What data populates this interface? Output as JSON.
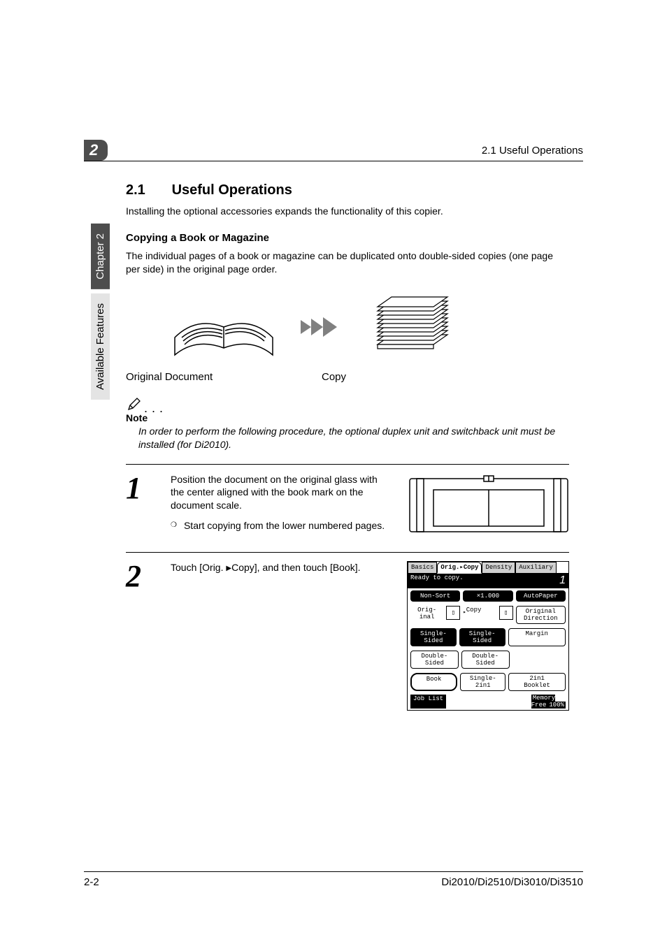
{
  "header": {
    "chapter_num": "2",
    "running_head": "2.1 Useful Operations"
  },
  "side_tabs": {
    "chapter": "Chapter 2",
    "section": "Available Features"
  },
  "section": {
    "number": "2.1",
    "title": "Useful Operations",
    "lead": "Installing the optional accessories expands the functionality of this copier."
  },
  "subsection": {
    "title": "Copying a Book or Magazine",
    "body": "The individual pages of a book or magazine can be duplicated onto double-sided copies (one page per side) in the original page order."
  },
  "captions": {
    "original": "Original Document",
    "copy": "Copy"
  },
  "note": {
    "label": "Note",
    "text": "In order to perform the following procedure, the optional duplex unit and switchback unit must be installed (for Di2010)."
  },
  "steps": [
    {
      "num": "1",
      "text": "Position the document on the original glass with the center aligned with the book mark on the document scale.",
      "bullet": "Start copying from the lower numbered pages."
    },
    {
      "num": "2",
      "text_a": "Touch [Orig. ",
      "text_b": "Copy], and then touch [Book]."
    }
  ],
  "touchscreen": {
    "tabs": [
      "Basics",
      "Orig.▸Copy",
      "Density",
      "Auxiliary"
    ],
    "status": "Ready to copy.",
    "count": "1",
    "row1": [
      "Non-Sort",
      "×1.000",
      "AutoPaper"
    ],
    "orig_label": "Orig-\ninal",
    "copy_label": "Copy",
    "right_col": [
      "Original\nDirection",
      "Margin"
    ],
    "left_btns": [
      "Single-\nSided",
      "Double-\nSided",
      "Book"
    ],
    "mid_btns": [
      "Single-\nSided",
      "Double-\nSided",
      "Single-2in1"
    ],
    "booklet": "2in1\nBooklet",
    "joblist": "Job List",
    "memory_label": "Memory\nFree",
    "memory_val": "100%"
  },
  "footer": {
    "page": "2-2",
    "models": "Di2010/Di2510/Di3010/Di3510"
  }
}
